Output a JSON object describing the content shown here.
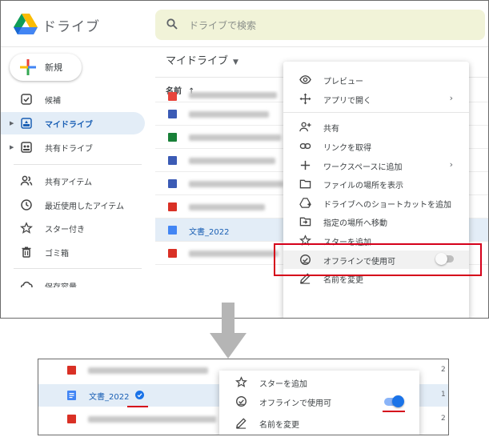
{
  "app": {
    "title": "ドライブ"
  },
  "search": {
    "placeholder": "ドライブで検索"
  },
  "new_button": "新規",
  "sidebar": [
    {
      "label": "候補",
      "icon": "check-square-icon"
    },
    {
      "label": "マイドライブ",
      "icon": "my-drive-icon",
      "active": true
    },
    {
      "label": "共有ドライブ",
      "icon": "shared-drive-icon"
    },
    {
      "label": "共有アイテム",
      "icon": "people-icon"
    },
    {
      "label": "最近使用したアイテム",
      "icon": "clock-icon"
    },
    {
      "label": "スター付き",
      "icon": "star-icon"
    },
    {
      "label": "ゴミ箱",
      "icon": "trash-icon"
    },
    {
      "label": "保存容量",
      "icon": "cloud-icon"
    }
  ],
  "breadcrumb": "マイドライブ",
  "columns": {
    "name": "名前",
    "sort": "↑"
  },
  "files": [
    {
      "type": "slides",
      "color": "#e8453c",
      "blurred": true
    },
    {
      "type": "forms",
      "color": "#3b5bb5",
      "blurred": true
    },
    {
      "type": "sheets",
      "color": "#188038",
      "blurred": true
    },
    {
      "type": "forms",
      "color": "#3b5bb5",
      "blurred": true
    },
    {
      "type": "forms",
      "color": "#3b5bb5",
      "blurred": true
    },
    {
      "type": "map",
      "color": "#d93025",
      "blurred": true
    },
    {
      "type": "docs",
      "color": "#4285f4",
      "name": "文書_2022"
    },
    {
      "type": "map",
      "color": "#d93025",
      "blurred": true
    }
  ],
  "context_menu": [
    {
      "label": "プレビュー",
      "icon": "eye-icon"
    },
    {
      "label": "アプリで開く",
      "icon": "move-arrows-icon",
      "submenu": "›"
    },
    {
      "label": "共有",
      "icon": "person-add-icon"
    },
    {
      "label": "リンクを取得",
      "icon": "link-icon"
    },
    {
      "label": "ワークスペースに追加",
      "icon": "plus-icon",
      "submenu": "›"
    },
    {
      "label": "ファイルの場所を表示",
      "icon": "folder-icon"
    },
    {
      "label": "ドライブへのショートカットを追加",
      "icon": "drive-shortcut-icon"
    },
    {
      "label": "指定の場所へ移動",
      "icon": "move-folder-icon"
    },
    {
      "label": "スターを追加",
      "icon": "star-icon"
    },
    {
      "label": "オフラインで使用可",
      "icon": "offline-check-icon",
      "toggle": false
    },
    {
      "label": "名前を変更",
      "icon": "pencil-icon"
    }
  ],
  "detail": {
    "file_name": "文書_2022",
    "menu": [
      {
        "label": "スターを追加",
        "icon": "star-icon"
      },
      {
        "label": "オフラインで使用可",
        "icon": "offline-check-icon",
        "toggle": true
      },
      {
        "label": "名前を変更",
        "icon": "pencil-icon"
      }
    ],
    "row_numbers": [
      "2",
      "1",
      "2"
    ]
  },
  "colors": {
    "accent": "#1a73e8",
    "highlight": "#d5001a",
    "selected_row": "#e3edf7",
    "search_bg": "#f1f3d8"
  }
}
